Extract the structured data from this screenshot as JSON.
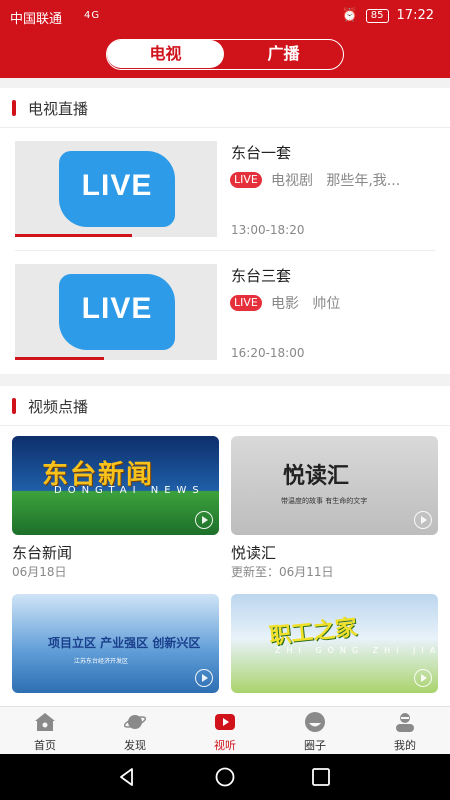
{
  "status_bar": {
    "carrier": "中国联通",
    "signal": "4G",
    "battery": "85",
    "time": "17:22"
  },
  "header": {
    "tabs": [
      {
        "label": "电视",
        "active": true
      },
      {
        "label": "广播",
        "active": false
      }
    ],
    "accent_color": "#d0121b"
  },
  "live_section": {
    "title": "电视直播",
    "items": [
      {
        "name": "东台一套",
        "badge": "LIVE",
        "category": "电视剧",
        "program": "那些年,我...",
        "time": "13:00-18:20",
        "thumb_text": "LIVE",
        "progress": 0.58
      },
      {
        "name": "东台三套",
        "badge": "LIVE",
        "category": "电影",
        "program": "帅位",
        "time": "16:20-18:00",
        "thumb_text": "LIVE",
        "progress": 0.44
      }
    ]
  },
  "vod_section": {
    "title": "视频点播",
    "items": [
      {
        "title": "东台新闻",
        "subtitle": "06月18日",
        "img_title": "东台新闻",
        "img_sub": "DONGTAI NEWS"
      },
      {
        "title": "悦读汇",
        "subtitle": "更新至：06月11日",
        "img_title": "悦读汇",
        "img_sub": "带温度的故事 有生命的文字"
      },
      {
        "title": "",
        "subtitle": "",
        "img_title": "项目立区 产业强区 创新兴区",
        "img_sub": "江苏东台经济开发区"
      },
      {
        "title": "",
        "subtitle": "",
        "img_title": "职工之家",
        "img_sub": "ZHI GONG ZHI JIA"
      }
    ]
  },
  "bottom_nav": {
    "items": [
      {
        "label": "首页",
        "icon": "home-icon"
      },
      {
        "label": "发现",
        "icon": "planet-icon"
      },
      {
        "label": "视听",
        "icon": "play-icon",
        "active": true
      },
      {
        "label": "圈子",
        "icon": "circle-face-icon"
      },
      {
        "label": "我的",
        "icon": "user-icon"
      }
    ]
  },
  "system_nav": {
    "buttons": [
      "back-icon",
      "home-circle-icon",
      "recents-icon"
    ]
  }
}
